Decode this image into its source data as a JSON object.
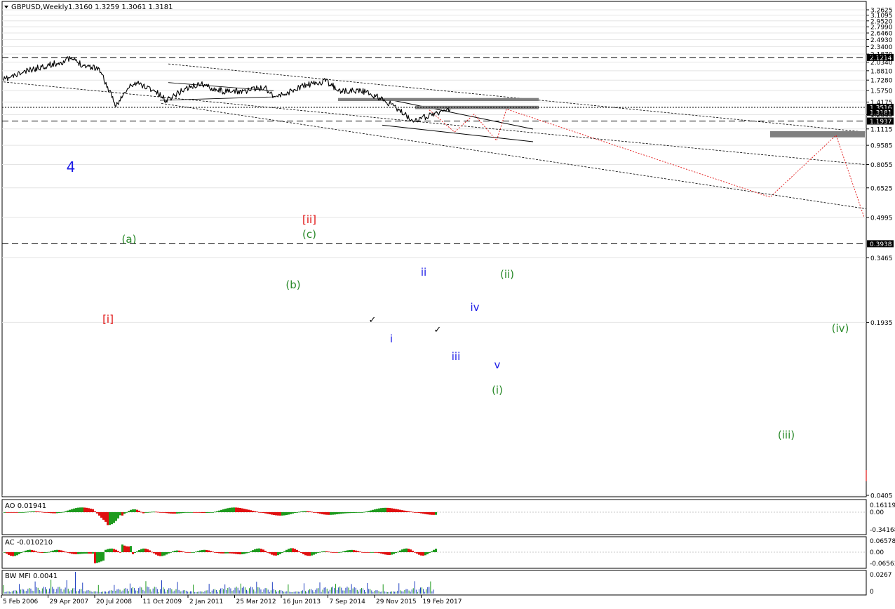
{
  "main": {
    "title": "GBPUSD,Weekly",
    "ohlc": "1.3160 1.3259 1.3061 1.3181",
    "price_ticks": [
      "3.2625",
      "3.1095",
      "2.9520",
      "2.7990",
      "2.6460",
      "2.4930",
      "2.3400",
      "2.1870",
      "2.0340",
      "1.8810",
      "1.7280",
      "1.5750",
      "1.4175",
      "1.2645",
      "1.1115",
      "0.9585",
      "0.8055",
      "0.6525",
      "0.4995",
      "0.3465",
      "0.1935",
      "0.0405"
    ],
    "price_levels": [
      {
        "label": "2.1214",
        "value": 2.1214,
        "style": "dashed"
      },
      {
        "label": "1.3516",
        "value": 1.3516,
        "style": "dotted"
      },
      {
        "label": "1.3181",
        "value": 1.3181,
        "style": "current"
      },
      {
        "label": "1.1937",
        "value": 1.1937,
        "style": "dashed"
      },
      {
        "label": "0.3938",
        "value": 0.3938,
        "style": "dashed"
      }
    ],
    "date_ticks": [
      "5 Feb 2006",
      "29 Apr 2007",
      "20 Jul 2008",
      "11 Oct 2009",
      "2 Jan 2011",
      "25 Mar 2012",
      "16 Jun 2013",
      "7 Sep 2014",
      "29 Nov 2015",
      "19 Feb 2017"
    ],
    "wave_labels": [
      {
        "text": "4",
        "color": "#1a1ae6",
        "size": 20
      },
      {
        "text": "(a)",
        "color": "#2a8a2a",
        "size": 15
      },
      {
        "text": "[i]",
        "color": "#e01010",
        "size": 15
      },
      {
        "text": "[ii]",
        "color": "#e01010",
        "size": 15
      },
      {
        "text": "(c)",
        "color": "#2a8a2a",
        "size": 15
      },
      {
        "text": "(b)",
        "color": "#2a8a2a",
        "size": 15
      },
      {
        "text": "ii",
        "color": "#1a1ae6",
        "size": 15
      },
      {
        "text": "(ii)",
        "color": "#2a8a2a",
        "size": 15
      },
      {
        "text": "iv",
        "color": "#1a1ae6",
        "size": 15
      },
      {
        "text": "i",
        "color": "#1a1ae6",
        "size": 15
      },
      {
        "text": "iii",
        "color": "#1a1ae6",
        "size": 15
      },
      {
        "text": "v",
        "color": "#1a1ae6",
        "size": 15
      },
      {
        "text": "(i)",
        "color": "#2a8a2a",
        "size": 15
      },
      {
        "text": "(iv)",
        "color": "#2a8a2a",
        "size": 15
      },
      {
        "text": "(iii)",
        "color": "#2a8a2a",
        "size": 15
      },
      {
        "text": "✓",
        "color": "#000000",
        "size": 13
      },
      {
        "text": "✓",
        "color": "#000000",
        "size": 13
      }
    ]
  },
  "indicators": [
    {
      "name": "AO 0.01941",
      "ticks": [
        "0.16119",
        "0.00",
        "-0.34168"
      ]
    },
    {
      "name": "AC -0.010210",
      "ticks": [
        "0.065785",
        "0.00",
        "-0.065631"
      ]
    },
    {
      "name": "BW MFI 0.0041",
      "ticks": [
        "0.0267",
        "0"
      ]
    }
  ],
  "colors": {
    "up": "#1e9a1e",
    "down": "#e01010",
    "price": "#000000",
    "mfi": "#2040c0",
    "forecast": "#e01010",
    "zone": "#808080"
  },
  "chart_data": {
    "type": "line",
    "x": [
      "2006-02",
      "2006-08",
      "2007-02",
      "2007-08",
      "2007-11",
      "2008-03",
      "2008-08",
      "2008-12",
      "2009-01",
      "2009-06",
      "2009-08",
      "2010-01",
      "2010-05",
      "2010-11",
      "2011-04",
      "2011-06",
      "2011-12",
      "2012-06",
      "2012-12",
      "2013-03",
      "2013-06",
      "2013-12",
      "2014-07",
      "2014-12",
      "2015-06",
      "2015-12",
      "2016-03",
      "2016-06",
      "2016-10",
      "2017-01",
      "2017-06",
      "2017-10"
    ],
    "y": [
      1.73,
      1.85,
      1.95,
      2.03,
      2.1,
      1.98,
      1.92,
      1.48,
      1.37,
      1.65,
      1.68,
      1.58,
      1.44,
      1.6,
      1.67,
      1.63,
      1.55,
      1.57,
      1.62,
      1.49,
      1.52,
      1.64,
      1.71,
      1.56,
      1.58,
      1.47,
      1.4,
      1.32,
      1.21,
      1.22,
      1.29,
      1.32
    ],
    "series": [
      {
        "name": "GBPUSD,Weekly",
        "values": [
          1.73,
          1.85,
          1.95,
          2.03,
          2.1,
          1.98,
          1.92,
          1.48,
          1.37,
          1.65,
          1.68,
          1.58,
          1.44,
          1.6,
          1.67,
          1.63,
          1.55,
          1.57,
          1.62,
          1.49,
          1.52,
          1.64,
          1.71,
          1.56,
          1.58,
          1.47,
          1.4,
          1.32,
          1.21,
          1.22,
          1.29,
          1.32
        ]
      }
    ],
    "ylim": [
      0.0405,
      3.2625
    ],
    "scale": "log",
    "grid": true,
    "title": "GBPUSD,Weekly"
  }
}
